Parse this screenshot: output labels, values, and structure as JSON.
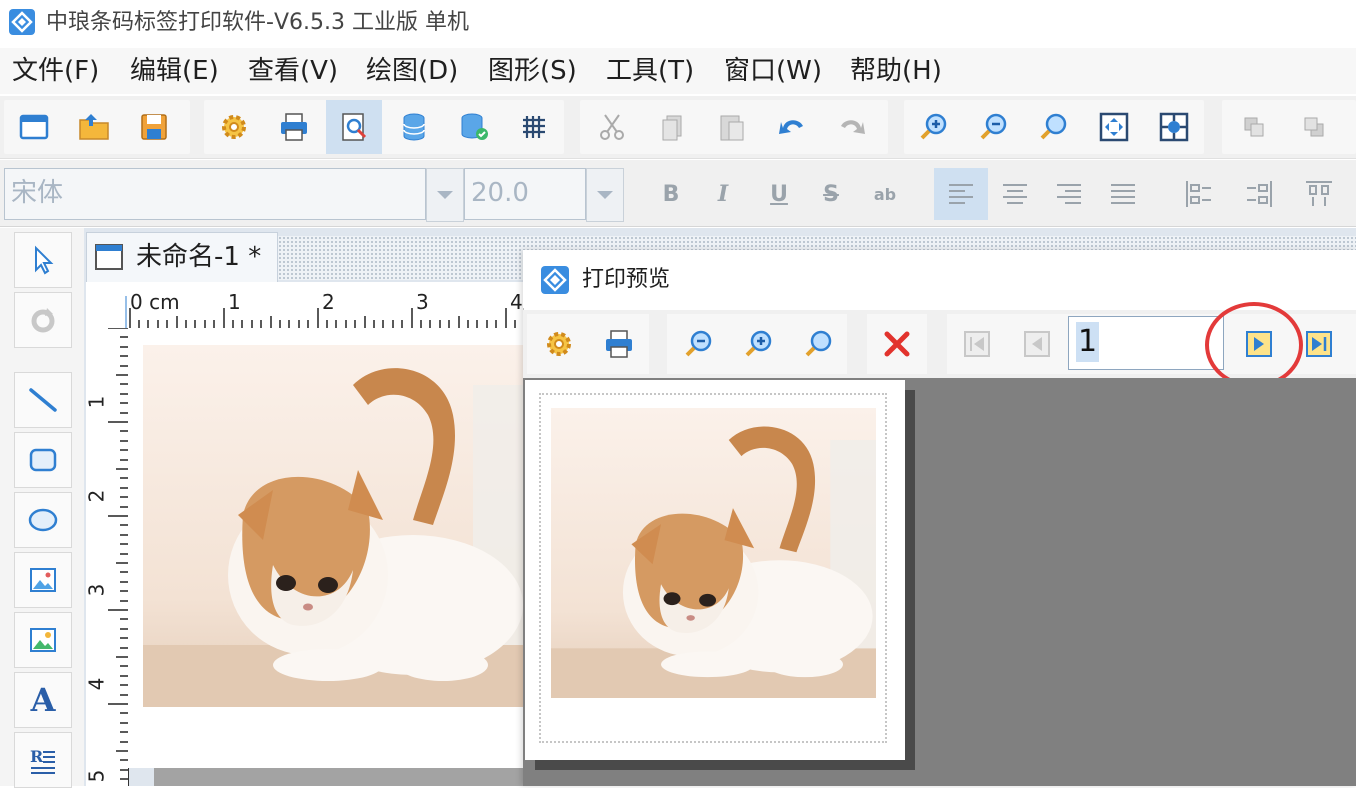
{
  "window": {
    "title": "中琅条码标签打印软件-V6.5.3 工业版 单机"
  },
  "menu": {
    "items": [
      "文件(F)",
      "编辑(E)",
      "查看(V)",
      "绘图(D)",
      "图形(S)",
      "工具(T)",
      "窗口(W)",
      "帮助(H)"
    ]
  },
  "toolbar": {
    "icons": [
      "new-document-icon",
      "open-folder-icon",
      "save-icon",
      "settings-gear-icon",
      "print-icon",
      "print-preview-icon",
      "database-icon",
      "database-connect-icon",
      "grid-icon",
      "cut-icon",
      "copy-icon",
      "paste-icon",
      "undo-icon",
      "redo-icon",
      "zoom-in-icon",
      "zoom-out-icon",
      "zoom-icon",
      "fit-page-icon",
      "actual-size-icon",
      "bring-forward-icon",
      "send-backward-icon"
    ]
  },
  "format_bar": {
    "font_name": "宋体",
    "font_size": "20.0",
    "bold": "B",
    "italic": "I",
    "underline": "U",
    "strike": "S",
    "abc": "ab"
  },
  "palette": {
    "text_tool": "A"
  },
  "document": {
    "tab_title": "未命名-1 *",
    "ruler_unit": "0 cm",
    "ruler_h_ticks": [
      "1",
      "2",
      "3",
      "4"
    ],
    "ruler_v_ticks": [
      "1",
      "2",
      "3",
      "4",
      "5"
    ]
  },
  "preview": {
    "title": "打印预览",
    "page_number": "1"
  },
  "colors": {
    "accent": "#cfe0f1",
    "highlight_circle": "#e33a3a",
    "preview_bg": "#808080"
  }
}
